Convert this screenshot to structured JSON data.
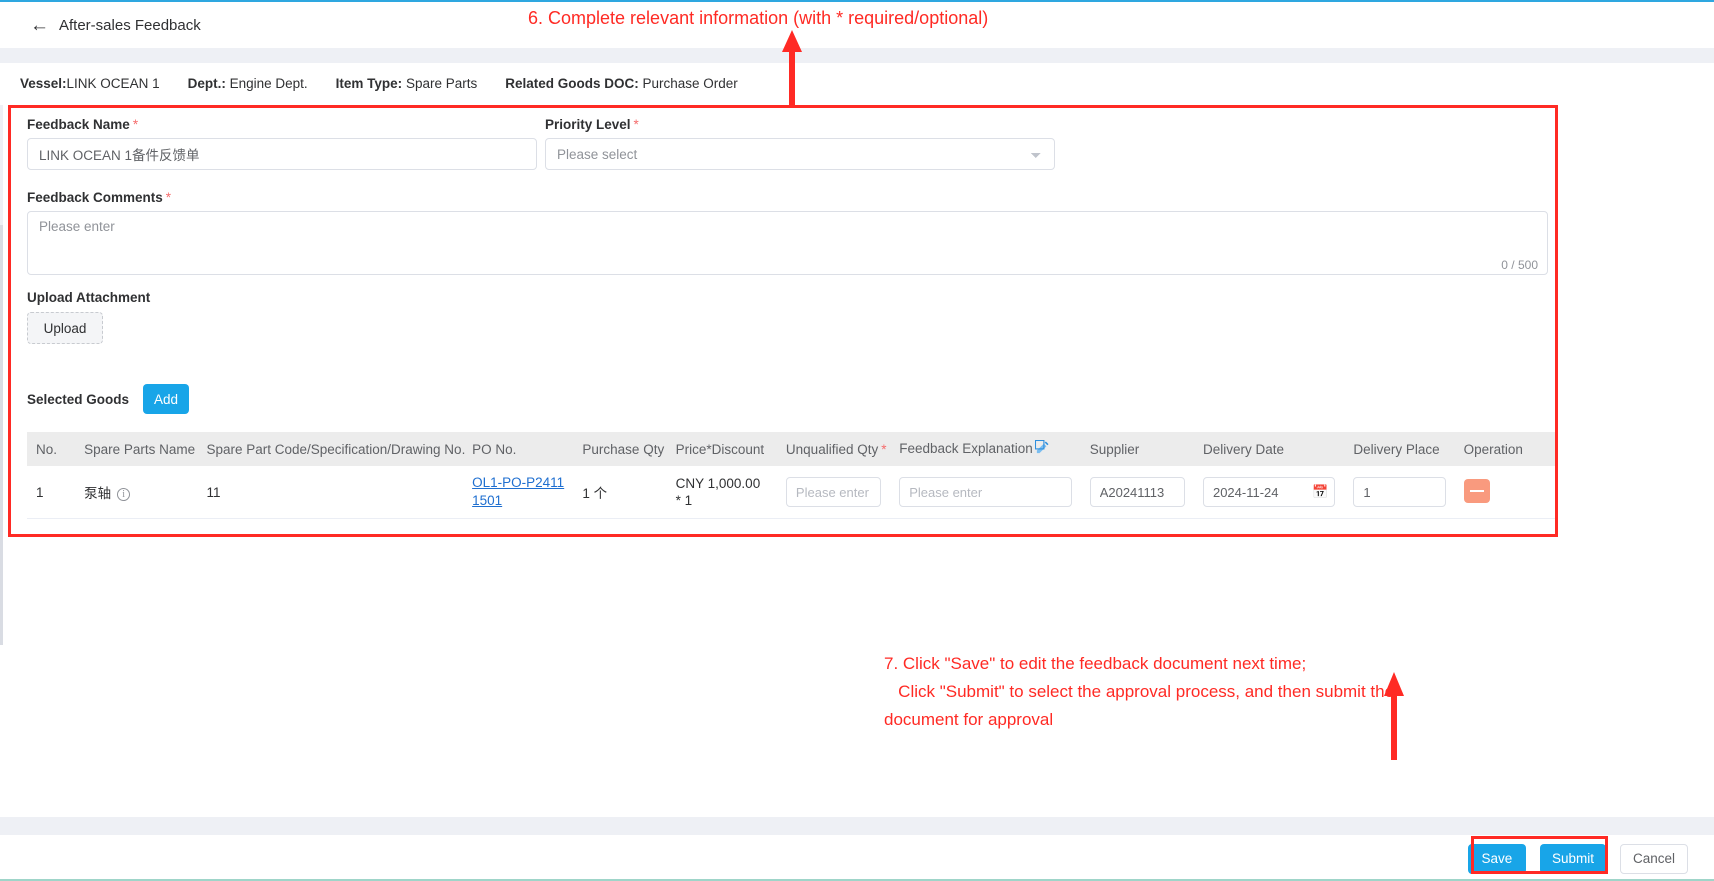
{
  "header": {
    "back_icon": "arrow-left-icon",
    "title": "After-sales Feedback"
  },
  "meta": {
    "vessel_label": "Vessel:",
    "vessel_value": "LINK OCEAN 1",
    "dept_label": "Dept.:",
    "dept_value": "Engine Dept.",
    "item_type_label": "Item Type:",
    "item_type_value": "Spare Parts",
    "related_doc_label": "Related Goods DOC:",
    "related_doc_value": "Purchase Order"
  },
  "form": {
    "feedback_name_label": "Feedback Name",
    "feedback_name_required": "*",
    "feedback_name_value": "LINK OCEAN 1备件反馈单",
    "priority_label": "Priority Level",
    "priority_required": "*",
    "priority_value": "Please select",
    "comments_label": "Feedback Comments",
    "comments_required": "*",
    "comments_placeholder": "Please enter",
    "comments_counter": "0 / 500",
    "upload_label": "Upload Attachment",
    "upload_button": "Upload"
  },
  "goods": {
    "title": "Selected Goods",
    "add_button": "Add",
    "columns": [
      "No.",
      "Spare Parts Name",
      "Spare Part Code/Specification/Drawing No.",
      "PO No.",
      "Purchase Qty",
      "Price*Discount",
      "Unqualified Qty",
      "Feedback Explanation",
      "Supplier",
      "Delivery Date",
      "Delivery Place",
      "Operation"
    ],
    "unqualified_required": "*",
    "feedback_explanation_icon": "batch-edit-icon",
    "rows": [
      {
        "no": "1",
        "spare_parts_name": "泵轴",
        "spare_parts_info_icon": "info-icon",
        "spare_part_code": "11",
        "po_no": "OL1-PO-P24111501",
        "purchase_qty": "1 个",
        "price_discount": "CNY 1,000.00 * 1",
        "unqualified_qty_placeholder": "Please enter",
        "unqualified_qty_value": "",
        "feedback_explanation_placeholder": "Please enter",
        "feedback_explanation_value": "",
        "supplier": "A20241113",
        "delivery_date": "2024-11-24",
        "delivery_date_icon": "calendar-icon",
        "delivery_place": "1",
        "operation_icon": "minus-remove-icon"
      }
    ]
  },
  "footer": {
    "save": "Save",
    "submit": "Submit",
    "cancel": "Cancel"
  },
  "annotations": {
    "top": "6. Complete relevant information (with * required/optional)",
    "bottom": "7. Click \"Save\" to edit the feedback document next time;\n   Click \"Submit\" to select the approval process, and then submit the\ndocument for approval",
    "accent_color": "#ff2a24"
  }
}
